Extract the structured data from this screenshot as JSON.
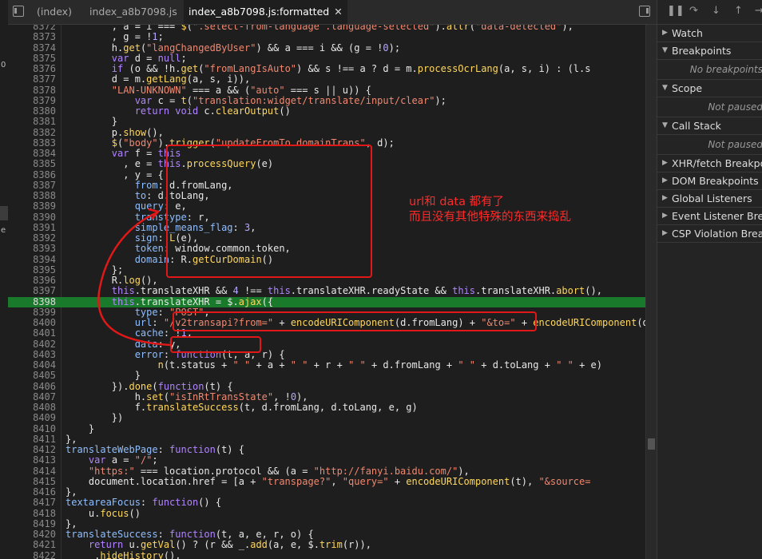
{
  "left_strip": {
    "items": [
      "0",
      "e"
    ]
  },
  "tabs": [
    {
      "label": "(index)"
    },
    {
      "label": "index_a8b7098.js"
    },
    {
      "label": "index_a8b7098.js:formatted",
      "active": true
    }
  ],
  "code_lines": [
    {
      "n": "8372",
      "t": "        , a = i === $(\".select-from-language .language-selected\").attr(\"data-detected\"),"
    },
    {
      "n": "8373",
      "t": "        , g = !1;"
    },
    {
      "n": "8374",
      "t": "        h.get(\"langChangedByUser\") && a === i && (g = !0);"
    },
    {
      "n": "8375",
      "t": "        var d = null;"
    },
    {
      "n": "8376",
      "t": "        if (o && !h.get(\"fromLangIsAuto\") && s !== a ? d = m.processOcrLang(a, s, i) : (l.s"
    },
    {
      "n": "8377",
      "t": "        d = m.getLang(a, s, i)),"
    },
    {
      "n": "8378",
      "t": "        \"LAN-UNKNOWN\" === a && (\"auto\" === s || u)) {"
    },
    {
      "n": "8379",
      "t": "            var c = t(\"translation:widget/translate/input/clear\");"
    },
    {
      "n": "8380",
      "t": "            return void c.clearOutput()"
    },
    {
      "n": "8381",
      "t": "        }"
    },
    {
      "n": "8382",
      "t": "        p.show(),"
    },
    {
      "n": "8383",
      "t": "        $(\"body\").trigger(\"updateFromTo.domainTrans\", d);"
    },
    {
      "n": "8384",
      "t": "        var f = this"
    },
    {
      "n": "8385",
      "t": "          , e = this.processQuery(e)"
    },
    {
      "n": "8386",
      "t": "          , y = {"
    },
    {
      "n": "8387",
      "t": "            from: d.fromLang,"
    },
    {
      "n": "8388",
      "t": "            to: d.toLang,"
    },
    {
      "n": "8389",
      "t": "            query: e,"
    },
    {
      "n": "8390",
      "t": "            transtype: r,"
    },
    {
      "n": "8391",
      "t": "            simple_means_flag: 3,"
    },
    {
      "n": "8392",
      "t": "            sign: L(e),"
    },
    {
      "n": "8393",
      "t": "            token: window.common.token,"
    },
    {
      "n": "8394",
      "t": "            domain: R.getCurDomain()"
    },
    {
      "n": "8395",
      "t": "        };"
    },
    {
      "n": "8396",
      "t": "        R.log(),"
    },
    {
      "n": "8397",
      "t": "        this.translateXHR && 4 !== this.translateXHR.readyState && this.translateXHR.abort(),"
    },
    {
      "n": "8398",
      "t": "        this.translateXHR = $.ajax({",
      "hl": true
    },
    {
      "n": "8399",
      "t": "            type: \"POST\","
    },
    {
      "n": "8400",
      "t": "            url: \"/v2transapi?from=\" + encodeURIComponent(d.fromLang) + \"&to=\" + encodeURIComponent(d.toLang),"
    },
    {
      "n": "8401",
      "t": "            cache: !1,"
    },
    {
      "n": "8402",
      "t": "            data: y,"
    },
    {
      "n": "8403",
      "t": "            error: function(t, a, r) {"
    },
    {
      "n": "8404",
      "t": "                n(t.status + \" \" + a + \" \" + r + \" \" + d.fromLang + \" \" + d.toLang + \" \" + e)"
    },
    {
      "n": "8405",
      "t": "            }"
    },
    {
      "n": "8406",
      "t": "        }).done(function(t) {"
    },
    {
      "n": "8407",
      "t": "            h.set(\"isInRtTransState\", !0),"
    },
    {
      "n": "8408",
      "t": "            f.translateSuccess(t, d.fromLang, d.toLang, e, g)"
    },
    {
      "n": "8409",
      "t": "        })"
    },
    {
      "n": "8410",
      "t": "    }"
    },
    {
      "n": "8411",
      "t": "},"
    },
    {
      "n": "8412",
      "t": "translateWebPage: function(t) {"
    },
    {
      "n": "8413",
      "t": "    var a = \"/\";"
    },
    {
      "n": "8414",
      "t": "    \"https:\" === location.protocol && (a = \"http://fanyi.baidu.com/\"),"
    },
    {
      "n": "8415",
      "t": "    document.location.href = [a + \"transpage?\", \"query=\" + encodeURIComponent(t), \"&source="
    },
    {
      "n": "8416",
      "t": "},"
    },
    {
      "n": "8417",
      "t": "textareaFocus: function() {"
    },
    {
      "n": "8418",
      "t": "    u.focus()"
    },
    {
      "n": "8419",
      "t": "},"
    },
    {
      "n": "8420",
      "t": "translateSuccess: function(t, a, e, r, o) {"
    },
    {
      "n": "8421",
      "t": "    return u.getVal() ? (r && _.add(a, e, $.trim(r)),"
    },
    {
      "n": "8422",
      "t": "    _.hideHistory(),"
    }
  ],
  "annotation": {
    "line1": "url和 data 都有了",
    "line2": "而且没有其他特殊的东西来捣乱"
  },
  "debugger": {
    "sections": [
      {
        "label": "Watch"
      },
      {
        "label": "Breakpoints",
        "expanded": true,
        "empty": "No breakpoints"
      },
      {
        "label": "Scope",
        "expanded": true,
        "empty": "Not paused"
      },
      {
        "label": "Call Stack",
        "expanded": true,
        "empty": "Not paused"
      },
      {
        "label": "XHR/fetch Breakpoints"
      },
      {
        "label": "DOM Breakpoints"
      },
      {
        "label": "Global Listeners"
      },
      {
        "label": "Event Listener Breakpoints"
      },
      {
        "label": "CSP Violation Breakpoints"
      }
    ]
  },
  "colors": {
    "highlight": "#1a7a2c",
    "annotation": "#e01818"
  }
}
